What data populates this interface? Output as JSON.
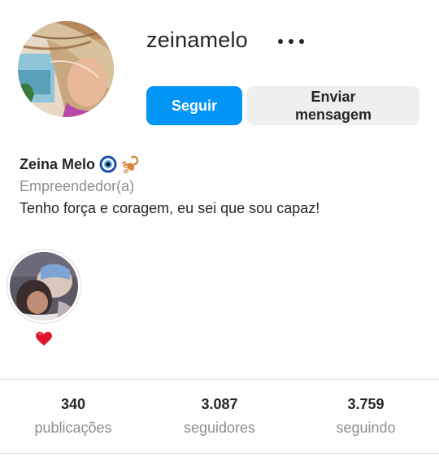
{
  "profile": {
    "username": "zeinamelo",
    "full_name": "Zeina Melo",
    "category": "Empreendedor(a)",
    "bio": "Tenho força e coragem, eu sei que sou capaz!",
    "name_emojis": [
      "nazar-amulet-icon",
      "scorpion-icon"
    ]
  },
  "actions": {
    "follow_label": "Seguir",
    "message_label": "Enviar mensagem",
    "more_icon": "more-horizontal-icon"
  },
  "highlights": [
    {
      "label_icon": "red-heart-icon"
    }
  ],
  "stats": [
    {
      "value": "340",
      "label": "publicações"
    },
    {
      "value": "3.087",
      "label": "seguidores"
    },
    {
      "value": "3.759",
      "label": "seguindo"
    }
  ],
  "colors": {
    "primary_button": "#0095f6",
    "secondary_button": "#efefef",
    "text": "#262626",
    "muted_text": "#8e8e8e",
    "divider": "#dbdbdb"
  }
}
